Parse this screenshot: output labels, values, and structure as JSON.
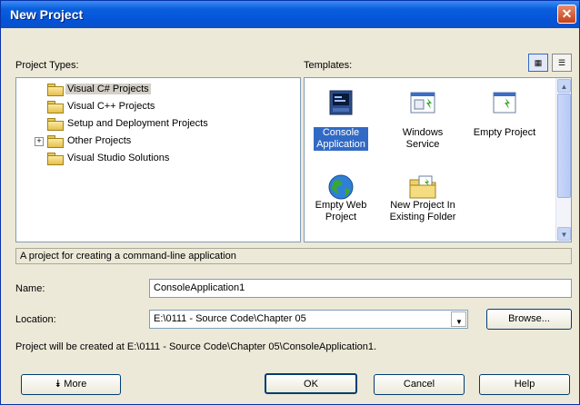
{
  "window": {
    "title": "New Project"
  },
  "project_types": {
    "label": "Project Types:",
    "items": [
      {
        "label": "Visual C# Projects",
        "selected": true,
        "expandable": false
      },
      {
        "label": "Visual C++ Projects",
        "selected": false,
        "expandable": false
      },
      {
        "label": "Setup and Deployment Projects",
        "selected": false,
        "expandable": false
      },
      {
        "label": "Other Projects",
        "selected": false,
        "expandable": true,
        "expander": "+"
      },
      {
        "label": "Visual Studio Solutions",
        "selected": false,
        "expandable": false
      }
    ]
  },
  "templates": {
    "label": "Templates:",
    "items": [
      {
        "label_line1": "Console",
        "label_line2": "Application",
        "icon": "console-app-icon",
        "selected": true
      },
      {
        "label_line1": "Windows",
        "label_line2": "Service",
        "icon": "windows-service-icon",
        "selected": false
      },
      {
        "label_line1": "Empty Project",
        "label_line2": "",
        "icon": "empty-project-icon",
        "selected": false
      },
      {
        "label_line1": "Empty Web",
        "label_line2": "Project",
        "icon": "empty-web-project-icon",
        "selected": false
      },
      {
        "label_line1": "New Project In",
        "label_line2": "Existing Folder",
        "icon": "existing-folder-icon",
        "selected": false
      }
    ]
  },
  "description": "A project for creating a command-line application",
  "name": {
    "label": "Name:",
    "value": "ConsoleApplication1"
  },
  "location": {
    "label": "Location:",
    "value": "E:\\0111 - Source Code\\Chapter 05"
  },
  "browse_button": "Browse...",
  "info": "Project will be created at E:\\0111 - Source Code\\Chapter 05\\ConsoleApplication1.",
  "buttons": {
    "more": "More",
    "ok": "OK",
    "cancel": "Cancel",
    "help": "Help"
  },
  "colors": {
    "titlebar": "#0454d8",
    "selection": "#316ac5",
    "dialog_bg": "#ece9d8"
  }
}
